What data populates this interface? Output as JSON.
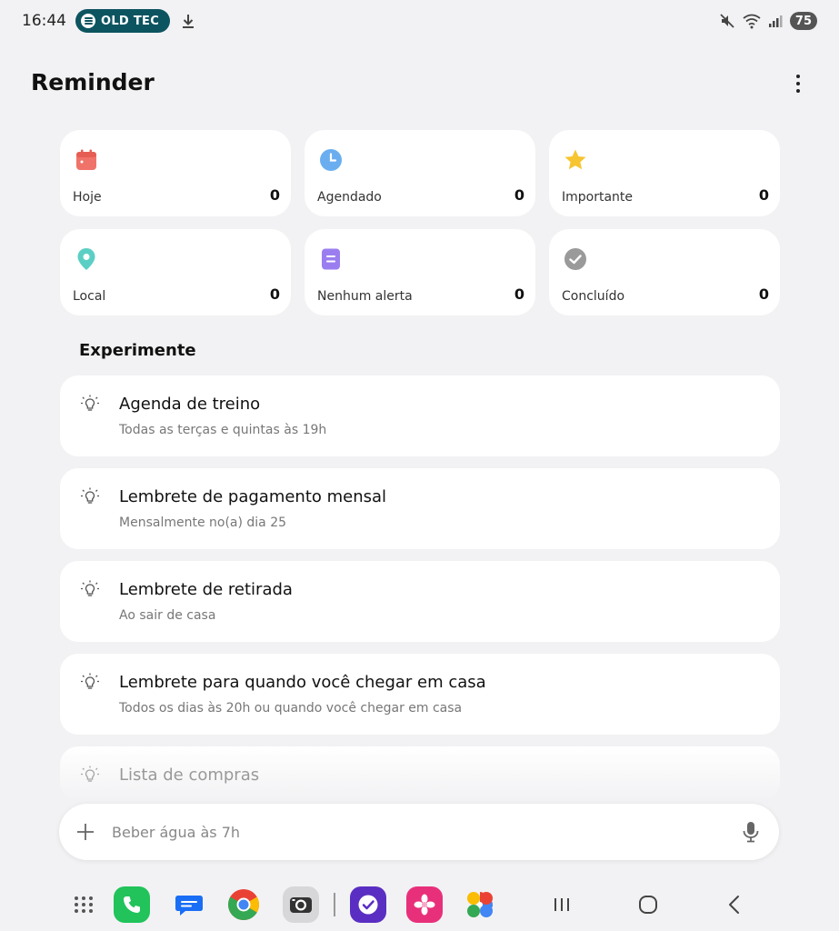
{
  "status_bar": {
    "time": "16:44",
    "media_title": "OLD TEC",
    "battery": "75"
  },
  "header": {
    "title": "Reminder"
  },
  "categories": [
    {
      "label": "Hoje",
      "count": "0",
      "icon": "calendar-icon",
      "color": "#f0736a"
    },
    {
      "label": "Agendado",
      "count": "0",
      "icon": "clock-icon",
      "color": "#6aaef0"
    },
    {
      "label": "Importante",
      "count": "0",
      "icon": "star-icon",
      "color": "#f7c531"
    },
    {
      "label": "Local",
      "count": "0",
      "icon": "location-pin-icon",
      "color": "#5ccfc4"
    },
    {
      "label": "Nenhum alerta",
      "count": "0",
      "icon": "note-icon",
      "color": "#9a7ef0"
    },
    {
      "label": "Concluído",
      "count": "0",
      "icon": "check-circle-icon",
      "color": "#9a9a9a"
    }
  ],
  "section": {
    "title": "Experimente"
  },
  "suggestions": [
    {
      "title": "Agenda de treino",
      "subtitle": "Todas as terças e quintas às 19h"
    },
    {
      "title": "Lembrete de pagamento mensal",
      "subtitle": "Mensalmente no(a) dia 25"
    },
    {
      "title": "Lembrete de retirada",
      "subtitle": "Ao sair de casa"
    },
    {
      "title": "Lembrete para quando você chegar em casa",
      "subtitle": "Todos os dias às 20h ou quando você chegar em casa"
    },
    {
      "title": "Lista de compras",
      "subtitle": ""
    }
  ],
  "input": {
    "placeholder": "Beber água às 7h"
  },
  "dock": {
    "apps": [
      "app-drawer-icon",
      "phone-icon",
      "messages-icon",
      "chrome-icon",
      "camera-icon",
      "reminder-icon",
      "gallery-icon",
      "photos-icon"
    ],
    "nav": [
      "recents-icon",
      "home-icon",
      "back-icon"
    ]
  },
  "colors": {
    "background": "#f2f2f4",
    "card": "#ffffff",
    "media_pill": "#0c5460"
  }
}
